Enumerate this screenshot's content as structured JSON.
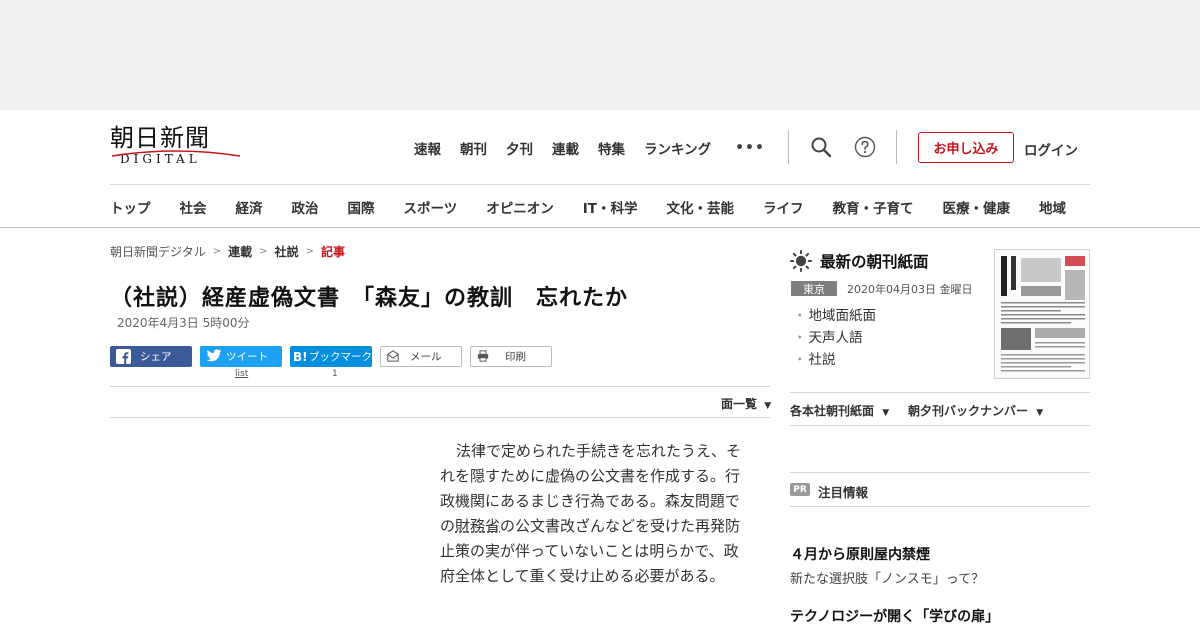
{
  "site": {
    "logo_kanji": "朝日新聞",
    "logo_sub": "DIGITAL"
  },
  "top_nav": [
    "速報",
    "朝刊",
    "夕刊",
    "連載",
    "特集",
    "ランキング"
  ],
  "more_label": "•••",
  "icons": {
    "more": "more-dots-icon",
    "search": "search-icon",
    "help": "help-icon",
    "sun": "sun-icon",
    "facebook": "facebook-icon",
    "twitter": "twitter-icon",
    "hatena": "hatena-bookmark-icon",
    "mail": "mail-icon",
    "print": "print-icon"
  },
  "apply_label": "お申し込み",
  "login_label": "ログイン",
  "categories": [
    "トップ",
    "社会",
    "経済",
    "政治",
    "国際",
    "スポーツ",
    "オピニオン",
    "IT・科学",
    "文化・芸能",
    "ライフ",
    "教育・子育て",
    "医療・健康",
    "地域"
  ],
  "breadcrumb": {
    "home": "朝日新聞デジタル",
    "sep": ">",
    "section": "連載",
    "subsection": "社説",
    "current": "記事"
  },
  "article": {
    "title": "（社説）経産虚偽文書　「森友」の教訓　忘れたか",
    "date": "2020年4月3日 5時00分",
    "body_before": "法律で定められた手続きを忘れたうえ、それを隠すために虚偽の公文書を作成する。行政機関にあるまじき行為である。森友問題での",
    "body_link": "財務省",
    "body_after": "の公文書改ざんなどを受けた再発防止策の実が伴っていないことは明らかで、政府全体として重く受け止める必要がある。"
  },
  "share": {
    "facebook_label": "シェア",
    "twitter_label": "ツイート",
    "twitter_count": "list",
    "hatena_badge": "B!",
    "hatena_label": "ブックマーク",
    "hatena_count": "1",
    "mail_label": "メール",
    "print_label": "印刷"
  },
  "page_list_label": "面一覧",
  "sidebar": {
    "heading": "最新の朝刊紙面",
    "edition": "東京",
    "edition_date": "2020年04月03日 金曜日",
    "links": [
      "地域面紙面",
      "天声人語",
      "社説"
    ],
    "menu1": "各本社朝刊紙面",
    "menu2": "朝夕刊バックナンバー",
    "pr_badge": "PR",
    "pr_label": "注目情報",
    "promos": [
      {
        "title": "４月から原則屋内禁煙",
        "sub": "新たな選択肢「ノンスモ」って？"
      },
      {
        "title": "テクノロジーが開く「学びの扉」",
        "sub": ""
      }
    ]
  },
  "colors": {
    "accent": "#c8131b",
    "facebook": "#3b5a98",
    "twitter": "#1da1f2",
    "hatena": "#008fde",
    "ad_band": "#f1f1f1"
  }
}
